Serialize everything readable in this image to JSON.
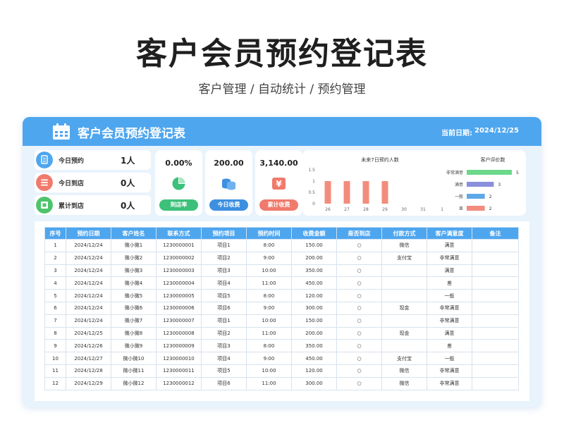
{
  "page": {
    "title": "客户会员预约登记表",
    "subtitle": "客户管理 / 自动统计 / 预约管理"
  },
  "header": {
    "title": "客户会员预约登记表",
    "date_label": "当前日期:",
    "date_value": "2024/12/25"
  },
  "stats": [
    {
      "label": "今日预约",
      "value": "1人",
      "icon": "document-icon",
      "color": "#4ea6ef"
    },
    {
      "label": "今日到店",
      "value": "0人",
      "icon": "list-icon",
      "color": "#f07a6c"
    },
    {
      "label": "累计到店",
      "value": "0人",
      "icon": "store-icon",
      "color": "#4cc46a"
    }
  ],
  "kpis": [
    {
      "value": "0.00%",
      "button": "到店率",
      "icon": "pie-chart-icon",
      "color": "#3cc07a"
    },
    {
      "value": "200.00",
      "button": "今日收费",
      "icon": "coins-icon",
      "color": "#3d8fe0"
    },
    {
      "value": "3,140.00",
      "button": "累计收费",
      "icon": "yen-icon",
      "color": "#f07a6c"
    }
  ],
  "colors": {
    "accent": "#4ea6ef",
    "bar": "#f28c7c",
    "page_bg": "#e9f3fc"
  },
  "chart_data": [
    {
      "type": "bar",
      "title": "未来7日预约人数",
      "categories": [
        "26",
        "27",
        "28",
        "29",
        "30",
        "31",
        "1"
      ],
      "values": [
        1,
        1,
        1,
        1,
        0,
        0,
        0
      ],
      "ylim": [
        0,
        1.5
      ],
      "yticks": [
        "1.5",
        "1",
        "0.5",
        "0"
      ]
    },
    {
      "type": "bar",
      "title": "客户评价数",
      "orientation": "horizontal",
      "categories": [
        "非常满意",
        "满意",
        "一般",
        "差"
      ],
      "values": [
        5,
        3,
        2,
        2
      ],
      "value_labels": [
        "5",
        "3",
        "2",
        "2"
      ],
      "colors": [
        "#6bd88a",
        "#8a8fdc",
        "#5ea8e8",
        "#f28c7c"
      ]
    }
  ],
  "table": {
    "headers": [
      "序号",
      "预约日期",
      "客户姓名",
      "联系方式",
      "预约项目",
      "预约时间",
      "收费金额",
      "是否到店",
      "付款方式",
      "客户满意度",
      "备注"
    ],
    "rows": [
      [
        "1",
        "2024/12/24",
        "微小微1",
        "1230000001",
        "项目1",
        "8:00",
        "150.00",
        "○",
        "微信",
        "满意",
        ""
      ],
      [
        "2",
        "2024/12/24",
        "微小微2",
        "1230000002",
        "项目2",
        "9:00",
        "200.00",
        "○",
        "支付宝",
        "非常满意",
        ""
      ],
      [
        "3",
        "2024/12/24",
        "微小微3",
        "1230000003",
        "项目3",
        "10:00",
        "350.00",
        "○",
        "",
        "满意",
        ""
      ],
      [
        "4",
        "2024/12/24",
        "微小微4",
        "1230000004",
        "项目4",
        "11:00",
        "450.00",
        "○",
        "",
        "差",
        ""
      ],
      [
        "5",
        "2024/12/24",
        "微小微5",
        "1230000005",
        "项目5",
        "8:00",
        "120.00",
        "○",
        "",
        "一般",
        ""
      ],
      [
        "6",
        "2024/12/24",
        "微小微6",
        "1230000006",
        "项目6",
        "9:00",
        "300.00",
        "○",
        "现金",
        "非常满意",
        ""
      ],
      [
        "7",
        "2024/12/24",
        "微小微7",
        "1230000007",
        "项目1",
        "10:00",
        "150.00",
        "○",
        "",
        "非常满意",
        ""
      ],
      [
        "8",
        "2024/12/25",
        "微小微8",
        "1230000008",
        "项目2",
        "11:00",
        "200.00",
        "○",
        "现金",
        "满意",
        ""
      ],
      [
        "9",
        "2024/12/26",
        "微小微9",
        "1230000009",
        "项目3",
        "8:00",
        "350.00",
        "○",
        "",
        "差",
        ""
      ],
      [
        "10",
        "2024/12/27",
        "微小微10",
        "1230000010",
        "项目4",
        "9:00",
        "450.00",
        "○",
        "支付宝",
        "一般",
        ""
      ],
      [
        "11",
        "2024/12/28",
        "微小微11",
        "1230000011",
        "项目5",
        "10:00",
        "120.00",
        "○",
        "微信",
        "非常满意",
        ""
      ],
      [
        "12",
        "2024/12/29",
        "微小微12",
        "1230000012",
        "项目6",
        "11:00",
        "300.00",
        "○",
        "微信",
        "非常满意",
        ""
      ]
    ]
  }
}
